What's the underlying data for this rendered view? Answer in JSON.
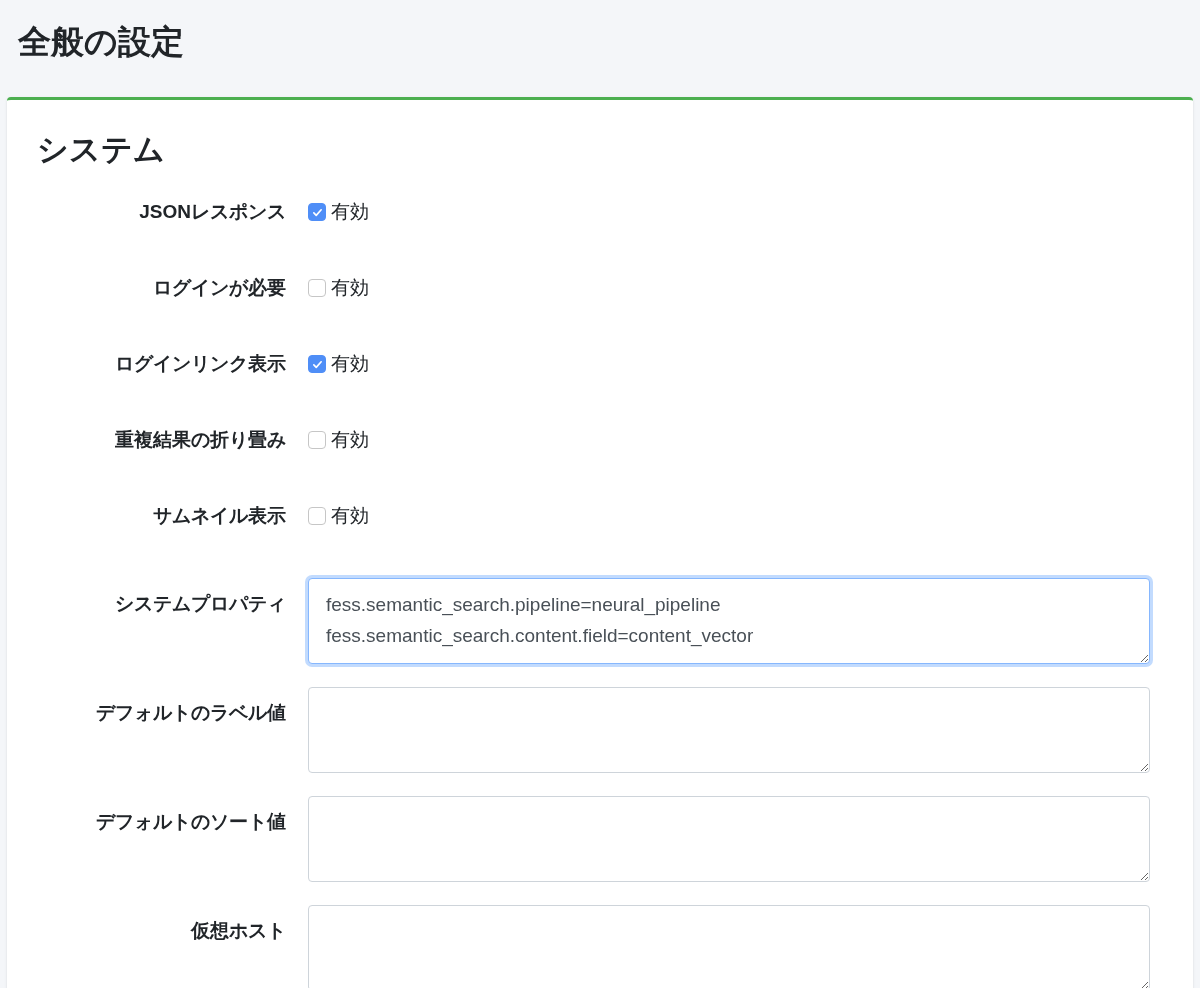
{
  "page": {
    "title": "全般の設定"
  },
  "section": {
    "title": "システム"
  },
  "fields": [
    {
      "kind": "checkbox",
      "label": "JSONレスポンス",
      "option": "有効",
      "checked": true
    },
    {
      "kind": "checkbox",
      "label": "ログインが必要",
      "option": "有効",
      "checked": false
    },
    {
      "kind": "checkbox",
      "label": "ログインリンク表示",
      "option": "有効",
      "checked": true
    },
    {
      "kind": "checkbox",
      "label": "重複結果の折り畳み",
      "option": "有効",
      "checked": false
    },
    {
      "kind": "checkbox",
      "label": "サムネイル表示",
      "option": "有効",
      "checked": false
    },
    {
      "kind": "textarea",
      "label": "システムプロパティ",
      "value": "fess.semantic_search.pipeline=neural_pipeline\nfess.semantic_search.content.field=content_vector",
      "focused": true
    },
    {
      "kind": "textarea",
      "label": "デフォルトのラベル値",
      "focused": false
    },
    {
      "kind": "textarea",
      "label": "デフォルトのソート値",
      "focused": false
    },
    {
      "kind": "textarea",
      "label": "仮想ホスト",
      "focused": false
    }
  ]
}
